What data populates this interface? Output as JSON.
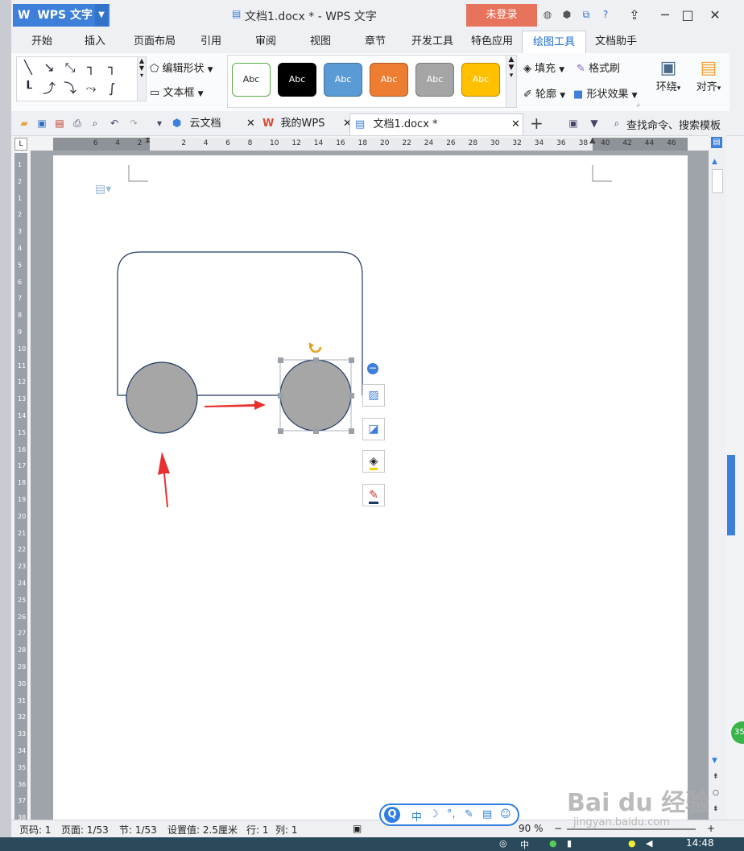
{
  "app": {
    "name": "WPS 文字",
    "doc_title": "文档1.docx * - WPS 文字",
    "login_label": "未登录"
  },
  "menu": {
    "tabs": [
      "开始",
      "插入",
      "页面布局",
      "引用",
      "审阅",
      "视图",
      "章节",
      "开发工具",
      "特色应用",
      "绘图工具",
      "文档助手"
    ],
    "active": "绘图工具"
  },
  "ribbon": {
    "edit_shape": "编辑形状",
    "text_box": "文本框",
    "styles": [
      {
        "label": "Abc",
        "bg": "#ffffff",
        "fg": "#222222",
        "border": "#5aa846"
      },
      {
        "label": "Abc",
        "bg": "#000000",
        "fg": "#ffffff",
        "border": "#000000"
      },
      {
        "label": "Abc",
        "bg": "#5b9bd5",
        "fg": "#ffffff",
        "border": "#41719c"
      },
      {
        "label": "Abc",
        "bg": "#ed7d31",
        "fg": "#ffffff",
        "border": "#ae5a21"
      },
      {
        "label": "Abc",
        "bg": "#a5a5a5",
        "fg": "#ffffff",
        "border": "#787878"
      },
      {
        "label": "Abc",
        "bg": "#ffc000",
        "fg": "#ffffff",
        "border": "#bc8c00"
      }
    ],
    "fill": "填充",
    "format_painter": "格式刷",
    "outline": "轮廓",
    "shape_effects": "形状效果",
    "wrap": "环绕",
    "align": "对齐"
  },
  "tabs": {
    "cloud": "云文档",
    "mywps": "我的WPS",
    "doc": "文档1.docx *",
    "search": "查找命令、搜索模板"
  },
  "ruler": {
    "h_left": [
      "6",
      "4",
      "2"
    ],
    "h_right": [
      "2",
      "4",
      "6",
      "8",
      "10",
      "12",
      "14",
      "16",
      "18",
      "20",
      "22",
      "24",
      "26",
      "28",
      "30",
      "32",
      "34",
      "36",
      "38",
      "40",
      "42",
      "44",
      "46"
    ],
    "v": [
      "1",
      "2",
      "1",
      "2",
      "3",
      "4",
      "5",
      "6",
      "7",
      "8",
      "9",
      "10",
      "11",
      "12",
      "13",
      "14",
      "15",
      "16",
      "17",
      "18",
      "19",
      "20",
      "21",
      "22",
      "23",
      "24",
      "25",
      "26",
      "27",
      "28",
      "29",
      "30",
      "31",
      "32",
      "33",
      "34",
      "35",
      "36",
      "37",
      "38"
    ]
  },
  "status": {
    "page_code": "页码: 1",
    "pages": "页面: 1/53",
    "section": "节: 1/53",
    "setting": "设置值: 2.5厘米",
    "row": "行: 1",
    "col": "列: 1",
    "zoom": "90 %"
  },
  "ime": {
    "lang": "中"
  },
  "watermark": {
    "brand": "Bai du 经验",
    "url": "jingyan.baidu.com"
  },
  "clock": "14:48",
  "colors": {
    "accent": "#3d7fd9",
    "shape_fill": "#a6a6a6",
    "shape_line": "#1f3864",
    "arrow": "#e8312f",
    "login": "#e8735c"
  }
}
